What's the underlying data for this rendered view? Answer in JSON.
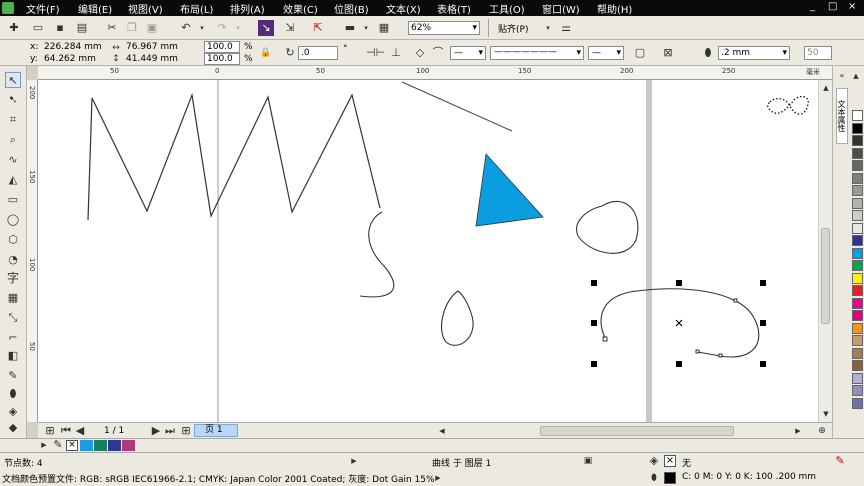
{
  "menu": [
    "文件(F)",
    "编辑(E)",
    "视图(V)",
    "布局(L)",
    "排列(A)",
    "效果(C)",
    "位图(B)",
    "文本(X)",
    "表格(T)",
    "工具(O)",
    "窗口(W)",
    "帮助(H)"
  ],
  "window_controls": [
    "_",
    "□",
    "×"
  ],
  "toolbar": {
    "zoom_value": "62%",
    "snap_label": "贴齐(P)"
  },
  "property_bar": {
    "x_label": "x:",
    "x_value": "226.284 mm",
    "y_label": "y:",
    "y_value": "64.262 mm",
    "w_value": "76.967 mm",
    "h_value": "41.449 mm",
    "scale_x": "100.0",
    "scale_y": "100.0",
    "percent": "%",
    "angle_value": ".0",
    "degree": "°",
    "outline_width": ".2 mm",
    "smooth_value": "50"
  },
  "hruler_labels": [
    "50",
    "0",
    "50",
    "100",
    "150",
    "200",
    "250"
  ],
  "vruler_labels": [
    "200",
    "150",
    "100",
    "50"
  ],
  "hruler_unit": "毫米",
  "right_dock_label": "文本属性",
  "pagebar": {
    "page_count": "1 / 1",
    "page_tab": "页 1"
  },
  "doc_colors": [
    "#1e9be0",
    "#1a7f5a",
    "#2a3b8f",
    "#b03a7a"
  ],
  "palette": [
    "#ffffff",
    "#000000",
    "#333333",
    "#4d4d4d",
    "#666666",
    "#808080",
    "#999999",
    "#b3b3b3",
    "#cccccc",
    "#e6e6e6",
    "#2e3192",
    "#00a0e9",
    "#00a650",
    "#fff200",
    "#ed1c24",
    "#ec008c",
    "#e4007f",
    "#f7941d",
    "#c69c6d",
    "#a67c52",
    "#8c6239",
    "#b0b0d0",
    "#9090c0",
    "#7070b0"
  ],
  "status": {
    "node_count": "节点数: 4",
    "object_info": "曲线 于 图层 1",
    "fill_none": "无",
    "color_profile": "文档颜色预置文件: RGB: sRGB IEC61966-2.1; CMYK: Japan Color 2001 Coated; 灰度: Dot Gain 15%",
    "outline_info": "C: 0 M: 0 Y: 0 K: 100  .200 mm"
  },
  "colors": {
    "triangle_fill": "#0a9ee0",
    "menubar_bg": "#0a0a0a"
  },
  "icons": {
    "toolbar": [
      "new-icon",
      "open-icon",
      "save-icon",
      "print-icon",
      "cut-icon",
      "copy-icon",
      "paste-icon",
      "undo-icon",
      "redo-icon",
      "import-icon",
      "export-icon",
      "app-launcher-icon",
      "welcome-icon"
    ],
    "tools": [
      "pick-tool-icon",
      "shape-tool-icon",
      "crop-tool-icon",
      "zoom-tool-icon",
      "freehand-tool-icon",
      "smart-fill-icon",
      "rectangle-tool-icon",
      "ellipse-tool-icon",
      "polygon-tool-icon",
      "basic-shapes-icon",
      "text-tool-icon",
      "table-tool-icon",
      "dimension-tool-icon",
      "connector-tool-icon",
      "blend-tool-icon",
      "eyedropper-icon",
      "outline-pen-icon",
      "fill-tool-icon",
      "interactive-fill-icon"
    ]
  }
}
